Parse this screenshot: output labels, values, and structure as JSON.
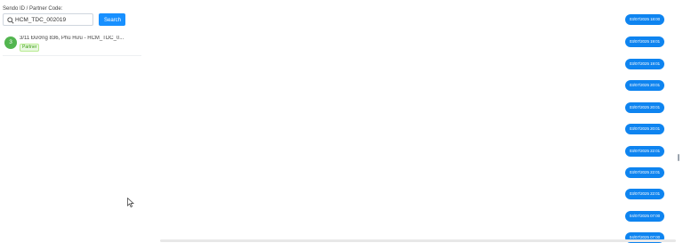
{
  "search": {
    "label": "Sendo ID / Partner Code:",
    "value": "HCM_TDC_002019",
    "button_label": "Search"
  },
  "results": [
    {
      "index": "3",
      "title": "3/11 Đường 836, Phú Hữu - HCM_TDC_0...",
      "tag": "Partner"
    }
  ],
  "timeline": {
    "badges": [
      "03/07/2025 18:00",
      "03/07/2025 19:01",
      "03/07/2025 19:01",
      "03/07/2025 20:01",
      "03/07/2025 20:01",
      "03/07/2025 20:01",
      "03/07/2025 22:01",
      "03/07/2025 22:01",
      "03/07/2025 22:01",
      "04/07/2025 07:00",
      "04/07/2025 07:00"
    ]
  },
  "colors": {
    "accent": "#1890ff",
    "badge": "#0e84f0",
    "avatar": "#52b54f",
    "tag_text": "#389e0d"
  }
}
